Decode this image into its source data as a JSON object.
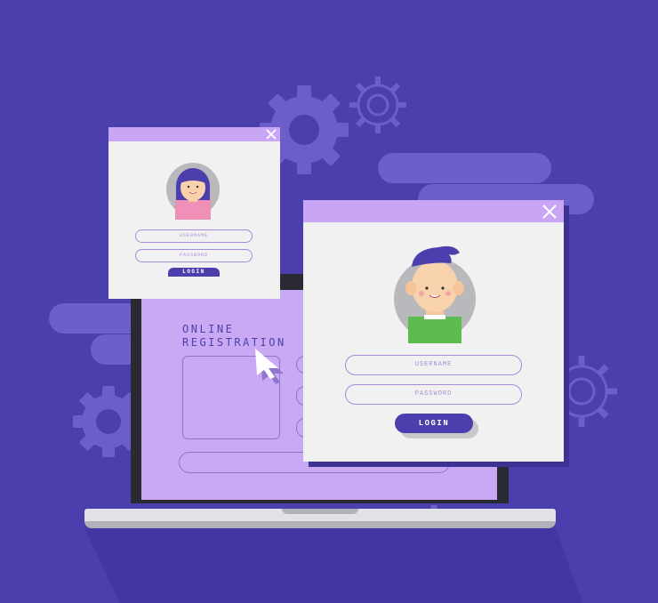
{
  "colors": {
    "background": "#4b3fae",
    "accent_light": "#c8a6f5",
    "screen": "#c9a9f3",
    "panel": "#f1f1f2",
    "field_border": "#a78bd9"
  },
  "laptop": {
    "title_line1": "ONLINE",
    "title_line2": "REGISTRATION"
  },
  "small_login": {
    "username_placeholder": "USERNAME",
    "password_placeholder": "PASSWORD",
    "login_label": "LOGIN",
    "close_icon": "close-icon",
    "avatar_icon": "female-avatar-icon"
  },
  "large_login": {
    "username_placeholder": "USERNAME",
    "password_placeholder": "PASSWORD",
    "login_label": "LOGIN",
    "close_icon": "close-icon",
    "avatar_icon": "male-avatar-icon"
  },
  "decor": {
    "gear_icon": "gear-icon",
    "cursor_icon": "cursor-icon"
  }
}
